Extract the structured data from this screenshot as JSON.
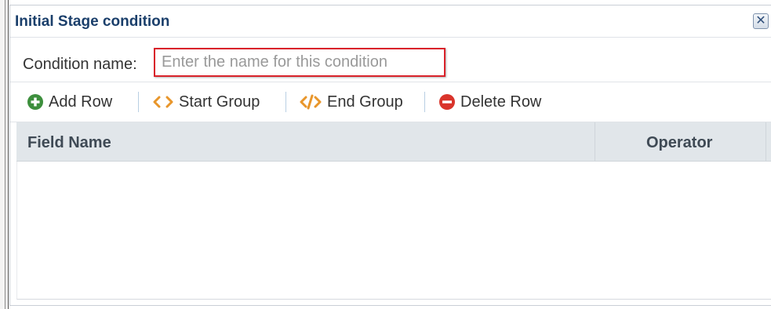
{
  "dialog": {
    "title": "Initial Stage condition",
    "close_glyph": "✕"
  },
  "condition": {
    "label": "Condition name:",
    "placeholder": "Enter the name for this condition",
    "value": ""
  },
  "toolbar": {
    "add_row": "Add Row",
    "start_group": "Start Group",
    "end_group": "End Group",
    "delete_row": "Delete Row"
  },
  "grid": {
    "columns": [
      "Field Name",
      "Operator"
    ],
    "rows": []
  },
  "colors": {
    "title": "#1b3f6b",
    "add_icon": "#3d8f3d",
    "group_icon": "#e8962b",
    "delete_icon": "#d9342b",
    "input_highlight": "#d9222a",
    "header_bg": "#e1e6ea"
  },
  "icons": {
    "close": "close-icon",
    "add": "plus-circle-icon",
    "start_group": "angle-brackets-icon",
    "end_group": "code-slash-icon",
    "delete": "minus-circle-icon"
  }
}
